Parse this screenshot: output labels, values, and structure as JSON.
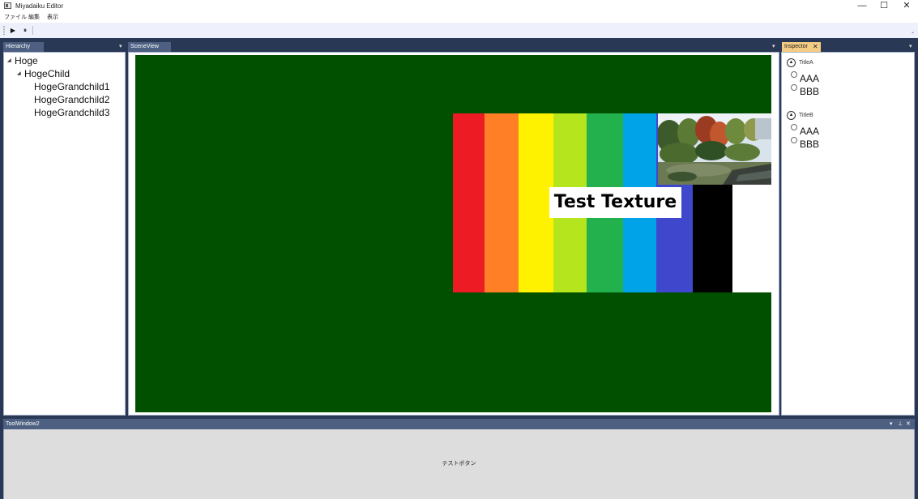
{
  "window": {
    "title": "Miyadaiku Editor",
    "controls": {
      "minimize": "—",
      "maximize": "☐",
      "close": "✕"
    }
  },
  "menu": [
    "ファイル",
    "編集",
    "表示"
  ],
  "toolbar": {
    "play": "▶",
    "pause": "⏸",
    "overflow": "⌄"
  },
  "hierarchy": {
    "tab": "Hierarchy",
    "tree": [
      {
        "label": "Hoge",
        "expanded": true,
        "level": 0
      },
      {
        "label": "HogeChild",
        "expanded": true,
        "level": 1
      },
      {
        "label": "HogeGrandchild1",
        "level": 2
      },
      {
        "label": "HogeGrandchild2",
        "level": 2
      },
      {
        "label": "HogeGrandchild3",
        "level": 2
      }
    ]
  },
  "scene": {
    "tab": "SceneView",
    "background_color": "#005000",
    "texture_label": "Test Texture",
    "stripe_colors": [
      "#ed1c24",
      "#ff7f27",
      "#fff200",
      "#b5e61d",
      "#22b14c",
      "#00a2e8",
      "#3f48cc",
      "#000000",
      "#ffffff"
    ]
  },
  "inspector": {
    "tab": "Inspector",
    "tab_close": "✕",
    "groups": [
      {
        "title": "TitleA",
        "options": [
          "AAA",
          "BBB"
        ]
      },
      {
        "title": "TitleB",
        "options": [
          "AAA",
          "BBB"
        ]
      }
    ]
  },
  "toolwindow": {
    "title": "ToolWindow2",
    "button_label": "テストボタン",
    "controls": {
      "menu": "▾",
      "pin": "⊥",
      "close": "✕"
    }
  },
  "panel_menu_glyph": "▾",
  "tree_arrow_glyph": "◢",
  "colors": {
    "dock_background": "#293955",
    "tab_background": "#4d6082",
    "active_tab": "#f5cc84",
    "toolbar": "#eef0fb"
  }
}
